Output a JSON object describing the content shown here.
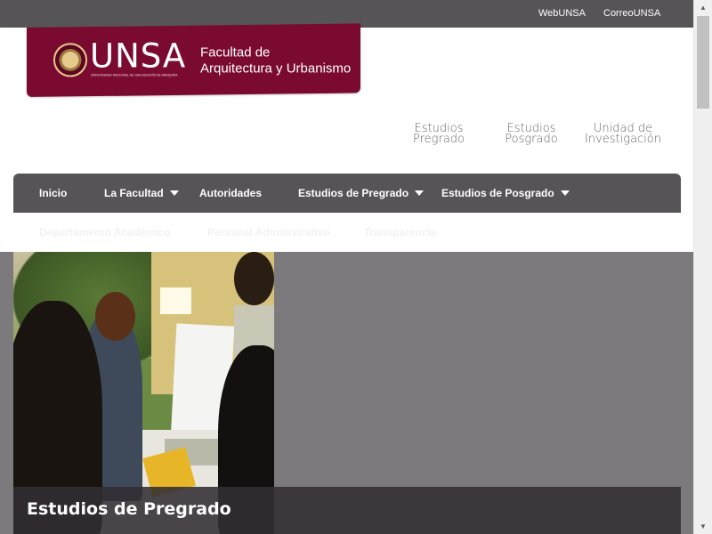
{
  "topbar": {
    "links": [
      "WebUNSA",
      "CorreoUNSA"
    ]
  },
  "header": {
    "logo_text": "UNSA",
    "logo_subtext": "UNIVERSIDAD NACIONAL DE SAN AGUSTÍN DE AREQUIPA",
    "faculty_line1": "Facultad de",
    "faculty_line2": "Arquitectura y Urbanismo",
    "brand_color": "#7a0a2f"
  },
  "quick_links": [
    {
      "line1": "Estudios",
      "line2": "Pregrado"
    },
    {
      "line1": "Estudios",
      "line2": "Posgrado"
    },
    {
      "line1": "Unidad de",
      "line2": "Investigación"
    }
  ],
  "nav": {
    "items": [
      {
        "label": "Inicio",
        "dropdown": false
      },
      {
        "label": "La Facultad",
        "dropdown": true
      },
      {
        "label": "Autoridades",
        "dropdown": false
      },
      {
        "label": "Estudios de Pregrado",
        "dropdown": true
      },
      {
        "label": "Estudios de Posgrado",
        "dropdown": true
      }
    ],
    "second_row": [
      "Departamento Académico",
      "Personal Administrativo",
      "Transparencia"
    ],
    "background_color": "#575457"
  },
  "hero": {
    "caption": "Estudios de Pregrado",
    "background_color": "#7c7a7d"
  },
  "icons": {
    "dropdown": "caret-down-icon",
    "scroll_up": "scroll-up-arrow-icon",
    "scroll_down": "scroll-down-arrow-icon"
  }
}
